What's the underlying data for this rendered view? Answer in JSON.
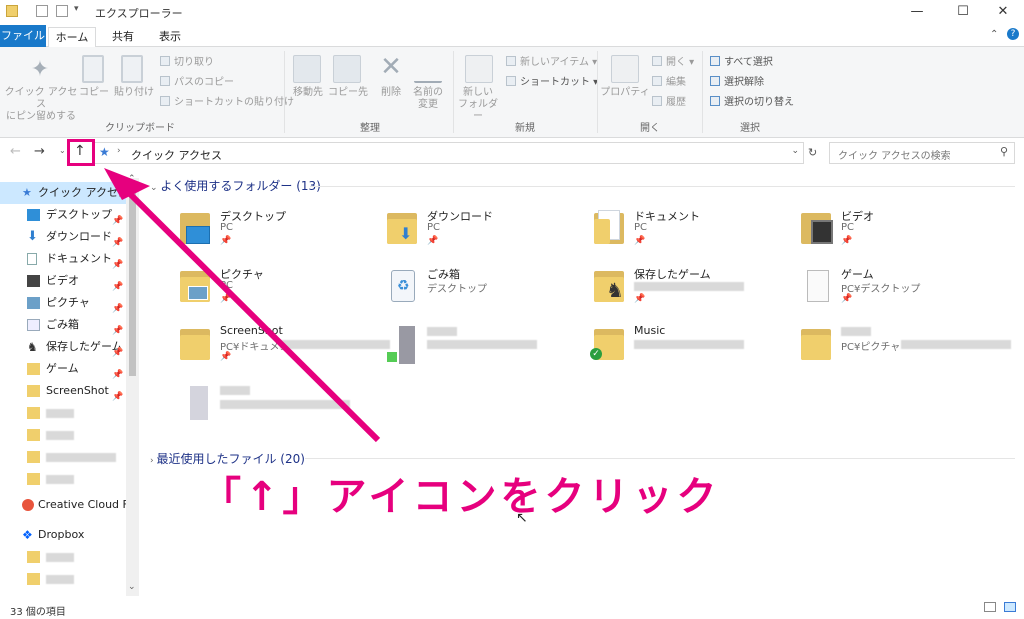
{
  "window": {
    "title": "エクスプローラー"
  },
  "tabs": {
    "file": "ファイル",
    "home": "ホーム",
    "share": "共有",
    "view": "表示"
  },
  "ribbon": {
    "pin": "クイック アクセス\nにピン留めする",
    "copy": "コピー",
    "paste": "貼り付け",
    "cut": "切り取り",
    "copy_path": "パスのコピー",
    "paste_shortcut": "ショートカットの貼り付け",
    "clipboard": "クリップボード",
    "move_to": "移動先",
    "copy_to": "コピー先",
    "delete": "削除",
    "rename": "名前の\n変更",
    "organize": "整理",
    "new_folder": "新しい\nフォルダー",
    "new_item": "新しいアイテム",
    "shortcut": "ショートカット",
    "new": "新規",
    "properties": "プロパティ",
    "open": "開く",
    "edit": "編集",
    "history": "履歴",
    "open_group": "開く",
    "select_all": "すべて選択",
    "select_none": "選択解除",
    "invert": "選択の切り替え",
    "select": "選択"
  },
  "address": {
    "path": "クイック アクセス",
    "search_placeholder": "クイック アクセスの検索"
  },
  "nav": {
    "quick_access": "クイック アクセス",
    "items": [
      "デスクトップ",
      "ダウンロード",
      "ドキュメント",
      "ビデオ",
      "ピクチャ",
      "ごみ箱",
      "保存したゲーム",
      "ゲーム",
      "ScreenShot"
    ],
    "creative": "Creative Cloud File",
    "dropbox": "Dropbox"
  },
  "content": {
    "frequent": "よく使用するフォルダー (13)",
    "recent": "最近使用したファイル (20)",
    "folders": [
      {
        "name": "デスクトップ",
        "sub": "PC"
      },
      {
        "name": "ダウンロード",
        "sub": "PC"
      },
      {
        "name": "ドキュメント",
        "sub": "PC"
      },
      {
        "name": "ビデオ",
        "sub": "PC"
      },
      {
        "name": "ピクチャ",
        "sub": "PC"
      },
      {
        "name": "ごみ箱",
        "sub": "デスクトップ"
      },
      {
        "name": "保存したゲーム",
        "sub": ""
      },
      {
        "name": "ゲーム",
        "sub": "PC¥デスクトップ"
      },
      {
        "name": "ScreenShot",
        "sub": "PC¥ドキュメン"
      },
      {
        "name": "",
        "sub": ""
      },
      {
        "name": "Music",
        "sub": ""
      },
      {
        "name": "",
        "sub": "PC¥ピクチャ"
      }
    ]
  },
  "status": {
    "count": "33 個の項目"
  },
  "annotation": "「↑」アイコンをクリック",
  "colors": {
    "accent": "#1979ca",
    "annotation": "#e6007e",
    "folder": "#f0cf6c"
  }
}
